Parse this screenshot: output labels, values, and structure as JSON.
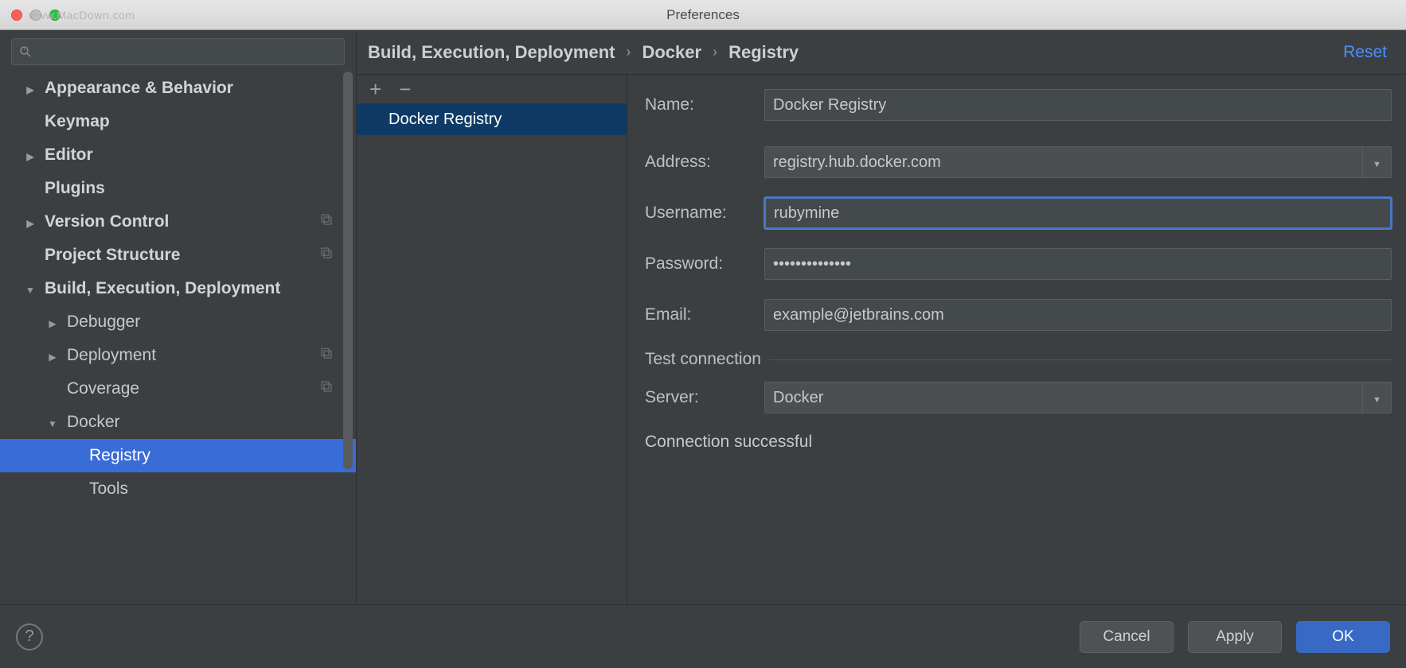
{
  "window": {
    "title": "Preferences",
    "watermark": "www.MacDown.com"
  },
  "sidebar": {
    "items": [
      {
        "label": "Appearance & Behavior",
        "arrow": "right",
        "bold": true,
        "indent": 0
      },
      {
        "label": "Keymap",
        "arrow": "",
        "bold": true,
        "indent": 0
      },
      {
        "label": "Editor",
        "arrow": "right",
        "bold": true,
        "indent": 0
      },
      {
        "label": "Plugins",
        "arrow": "",
        "bold": true,
        "indent": 0
      },
      {
        "label": "Version Control",
        "arrow": "right",
        "bold": true,
        "indent": 0,
        "badge": true
      },
      {
        "label": "Project Structure",
        "arrow": "",
        "bold": true,
        "indent": 0,
        "badge": true
      },
      {
        "label": "Build, Execution, Deployment",
        "arrow": "down",
        "bold": true,
        "indent": 0
      },
      {
        "label": "Debugger",
        "arrow": "right",
        "bold": false,
        "indent": 1
      },
      {
        "label": "Deployment",
        "arrow": "right",
        "bold": false,
        "indent": 1,
        "badge": true
      },
      {
        "label": "Coverage",
        "arrow": "",
        "bold": false,
        "indent": 1,
        "badge": true
      },
      {
        "label": "Docker",
        "arrow": "down",
        "bold": false,
        "indent": 1
      },
      {
        "label": "Registry",
        "arrow": "",
        "bold": false,
        "indent": 2,
        "selected": true
      },
      {
        "label": "Tools",
        "arrow": "",
        "bold": false,
        "indent": 2
      }
    ]
  },
  "breadcrumb": {
    "a": "Build, Execution, Deployment",
    "b": "Docker",
    "c": "Registry",
    "sep": "›"
  },
  "reset_label": "Reset",
  "list": {
    "items": [
      {
        "label": "Docker Registry",
        "selected": true
      }
    ]
  },
  "form": {
    "name_label": "Name:",
    "name_value": "Docker Registry",
    "address_label": "Address:",
    "address_value": "registry.hub.docker.com",
    "username_label": "Username:",
    "username_value": "rubymine",
    "password_label": "Password:",
    "password_value": "••••••••••••••",
    "email_label": "Email:",
    "email_value": "example@jetbrains.com",
    "test_legend": "Test connection",
    "server_label": "Server:",
    "server_value": "Docker",
    "status": "Connection successful"
  },
  "footer": {
    "cancel": "Cancel",
    "apply": "Apply",
    "ok": "OK",
    "help": "?"
  }
}
